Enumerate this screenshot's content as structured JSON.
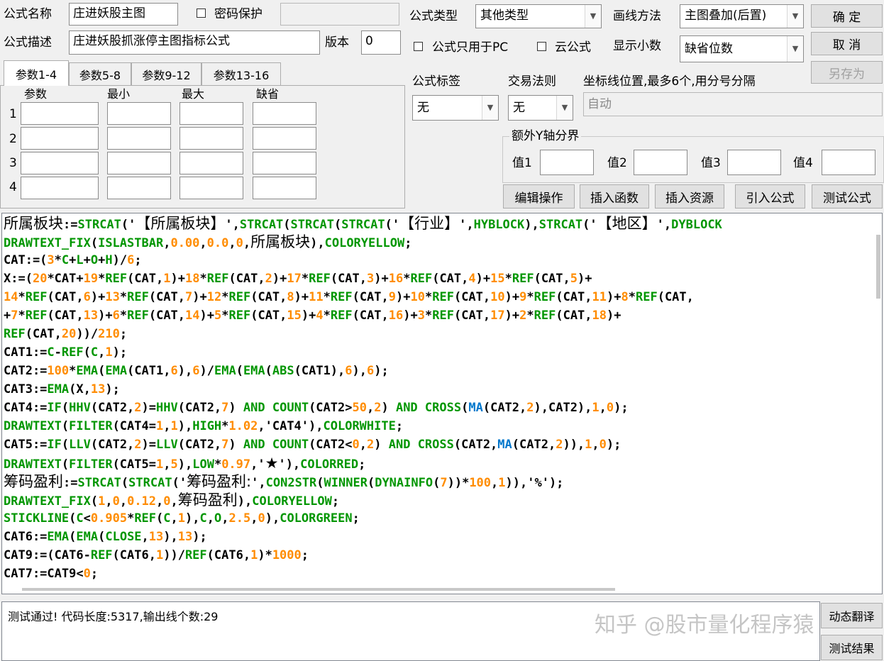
{
  "form": {
    "name_label": "公式名称",
    "name_value": "庄进妖股主图",
    "password_label": "密码保护",
    "desc_label": "公式描述",
    "desc_value": "庄进妖股抓涨停主图指标公式",
    "version_label": "版本",
    "version_value": "0",
    "type_label": "公式类型",
    "type_value": "其他类型",
    "draw_label": "画线方法",
    "draw_value": "主图叠加(后置)",
    "pc_only_label": "公式只用于PC",
    "cloud_label": "云公式",
    "decimal_label": "显示小数",
    "decimal_value": "缺省位数",
    "tag_label": "公式标签",
    "tag_value": "无",
    "trade_label": "交易法则",
    "trade_value": "无",
    "axis_label": "坐标线位置,最多6个,用分号分隔",
    "axis_placeholder": "自动",
    "yaxis_group": "额外Y轴分界",
    "y1": "值1",
    "y2": "值2",
    "y3": "值3",
    "y4": "值4"
  },
  "buttons": {
    "ok": "确  定",
    "cancel": "取  消",
    "save_as": "另存为",
    "edit": "编辑操作",
    "insert_func": "插入函数",
    "insert_res": "插入资源",
    "import": "引入公式",
    "test": "测试公式",
    "translate": "动态翻译",
    "test_result": "测试结果"
  },
  "tabs": [
    "参数1-4",
    "参数5-8",
    "参数9-12",
    "参数13-16"
  ],
  "params": {
    "headers": [
      "参数",
      "最小",
      "最大",
      "缺省"
    ],
    "rows": [
      "1",
      "2",
      "3",
      "4"
    ]
  },
  "code": [
    [
      [
        "cn",
        "所属板块"
      ],
      [
        "k",
        ":="
      ],
      [
        "f",
        "STRCAT"
      ],
      [
        "k",
        "('"
      ],
      [
        "cn",
        "【所属板块】"
      ],
      [
        "k",
        "',"
      ],
      [
        "f",
        "STRCAT"
      ],
      [
        "k",
        "("
      ],
      [
        "f",
        "STRCAT"
      ],
      [
        "k",
        "("
      ],
      [
        "f",
        "STRCAT"
      ],
      [
        "k",
        "('"
      ],
      [
        "cn",
        "【行业】"
      ],
      [
        "k",
        "',"
      ],
      [
        "f",
        "HYBLOCK"
      ],
      [
        "k",
        "),"
      ],
      [
        "f",
        "STRCAT"
      ],
      [
        "k",
        "('"
      ],
      [
        "cn",
        "【地区】"
      ],
      [
        "k",
        "',"
      ],
      [
        "f",
        "DYBLOCK"
      ]
    ],
    [
      [
        "f",
        "DRAWTEXT_FIX"
      ],
      [
        "k",
        "("
      ],
      [
        "f",
        "ISLASTBAR"
      ],
      [
        "k",
        ","
      ],
      [
        "n",
        "0.00"
      ],
      [
        "k",
        ","
      ],
      [
        "n",
        "0.0"
      ],
      [
        "k",
        ","
      ],
      [
        "n",
        "0"
      ],
      [
        "k",
        ","
      ],
      [
        "cn",
        "所属板块"
      ],
      [
        "k",
        "),"
      ],
      [
        "f",
        "COLORYELLOW"
      ],
      [
        "k",
        ";"
      ]
    ],
    [
      [
        "k",
        "CAT:=("
      ],
      [
        "n",
        "3"
      ],
      [
        "k",
        "*"
      ],
      [
        "f",
        "C"
      ],
      [
        "k",
        "+"
      ],
      [
        "f",
        "L"
      ],
      [
        "k",
        "+"
      ],
      [
        "f",
        "O"
      ],
      [
        "k",
        "+"
      ],
      [
        "f",
        "H"
      ],
      [
        "k",
        ")/"
      ],
      [
        "n",
        "6"
      ],
      [
        "k",
        ";"
      ]
    ],
    [
      [
        "k",
        "X:=("
      ],
      [
        "n",
        "20"
      ],
      [
        "k",
        "*CAT+"
      ],
      [
        "n",
        "19"
      ],
      [
        "k",
        "*"
      ],
      [
        "f",
        "REF"
      ],
      [
        "k",
        "(CAT,"
      ],
      [
        "n",
        "1"
      ],
      [
        "k",
        ")+"
      ],
      [
        "n",
        "18"
      ],
      [
        "k",
        "*"
      ],
      [
        "f",
        "REF"
      ],
      [
        "k",
        "(CAT,"
      ],
      [
        "n",
        "2"
      ],
      [
        "k",
        ")+"
      ],
      [
        "n",
        "17"
      ],
      [
        "k",
        "*"
      ],
      [
        "f",
        "REF"
      ],
      [
        "k",
        "(CAT,"
      ],
      [
        "n",
        "3"
      ],
      [
        "k",
        ")+"
      ],
      [
        "n",
        "16"
      ],
      [
        "k",
        "*"
      ],
      [
        "f",
        "REF"
      ],
      [
        "k",
        "(CAT,"
      ],
      [
        "n",
        "4"
      ],
      [
        "k",
        ")+"
      ],
      [
        "n",
        "15"
      ],
      [
        "k",
        "*"
      ],
      [
        "f",
        "REF"
      ],
      [
        "k",
        "(CAT,"
      ],
      [
        "n",
        "5"
      ],
      [
        "k",
        ")+"
      ]
    ],
    [
      [
        "n",
        "14"
      ],
      [
        "k",
        "*"
      ],
      [
        "f",
        "REF"
      ],
      [
        "k",
        "(CAT,"
      ],
      [
        "n",
        "6"
      ],
      [
        "k",
        ")+"
      ],
      [
        "n",
        "13"
      ],
      [
        "k",
        "*"
      ],
      [
        "f",
        "REF"
      ],
      [
        "k",
        "(CAT,"
      ],
      [
        "n",
        "7"
      ],
      [
        "k",
        ")+"
      ],
      [
        "n",
        "12"
      ],
      [
        "k",
        "*"
      ],
      [
        "f",
        "REF"
      ],
      [
        "k",
        "(CAT,"
      ],
      [
        "n",
        "8"
      ],
      [
        "k",
        ")+"
      ],
      [
        "n",
        "11"
      ],
      [
        "k",
        "*"
      ],
      [
        "f",
        "REF"
      ],
      [
        "k",
        "(CAT,"
      ],
      [
        "n",
        "9"
      ],
      [
        "k",
        ")+"
      ],
      [
        "n",
        "10"
      ],
      [
        "k",
        "*"
      ],
      [
        "f",
        "REF"
      ],
      [
        "k",
        "(CAT,"
      ],
      [
        "n",
        "10"
      ],
      [
        "k",
        ")+"
      ],
      [
        "n",
        "9"
      ],
      [
        "k",
        "*"
      ],
      [
        "f",
        "REF"
      ],
      [
        "k",
        "(CAT,"
      ],
      [
        "n",
        "11"
      ],
      [
        "k",
        ")+"
      ],
      [
        "n",
        "8"
      ],
      [
        "k",
        "*"
      ],
      [
        "f",
        "REF"
      ],
      [
        "k",
        "(CAT,"
      ]
    ],
    [
      [
        "k",
        "+"
      ],
      [
        "n",
        "7"
      ],
      [
        "k",
        "*"
      ],
      [
        "f",
        "REF"
      ],
      [
        "k",
        "(CAT,"
      ],
      [
        "n",
        "13"
      ],
      [
        "k",
        ")+"
      ],
      [
        "n",
        "6"
      ],
      [
        "k",
        "*"
      ],
      [
        "f",
        "REF"
      ],
      [
        "k",
        "(CAT,"
      ],
      [
        "n",
        "14"
      ],
      [
        "k",
        ")+"
      ],
      [
        "n",
        "5"
      ],
      [
        "k",
        "*"
      ],
      [
        "f",
        "REF"
      ],
      [
        "k",
        "(CAT,"
      ],
      [
        "n",
        "15"
      ],
      [
        "k",
        ")+"
      ],
      [
        "n",
        "4"
      ],
      [
        "k",
        "*"
      ],
      [
        "f",
        "REF"
      ],
      [
        "k",
        "(CAT,"
      ],
      [
        "n",
        "16"
      ],
      [
        "k",
        ")+"
      ],
      [
        "n",
        "3"
      ],
      [
        "k",
        "*"
      ],
      [
        "f",
        "REF"
      ],
      [
        "k",
        "(CAT,"
      ],
      [
        "n",
        "17"
      ],
      [
        "k",
        ")+"
      ],
      [
        "n",
        "2"
      ],
      [
        "k",
        "*"
      ],
      [
        "f",
        "REF"
      ],
      [
        "k",
        "(CAT,"
      ],
      [
        "n",
        "18"
      ],
      [
        "k",
        ")+"
      ]
    ],
    [
      [
        "f",
        "REF"
      ],
      [
        "k",
        "(CAT,"
      ],
      [
        "n",
        "20"
      ],
      [
        "k",
        "))/"
      ],
      [
        "n",
        "210"
      ],
      [
        "k",
        ";"
      ]
    ],
    [
      [
        "k",
        "CAT1:="
      ],
      [
        "f",
        "C"
      ],
      [
        "k",
        "-"
      ],
      [
        "f",
        "REF"
      ],
      [
        "k",
        "("
      ],
      [
        "f",
        "C"
      ],
      [
        "k",
        ","
      ],
      [
        "n",
        "1"
      ],
      [
        "k",
        ");"
      ]
    ],
    [
      [
        "k",
        "CAT2:="
      ],
      [
        "n",
        "100"
      ],
      [
        "k",
        "*"
      ],
      [
        "f",
        "EMA"
      ],
      [
        "k",
        "("
      ],
      [
        "f",
        "EMA"
      ],
      [
        "k",
        "(CAT1,"
      ],
      [
        "n",
        "6"
      ],
      [
        "k",
        "),"
      ],
      [
        "n",
        "6"
      ],
      [
        "k",
        ")/"
      ],
      [
        "f",
        "EMA"
      ],
      [
        "k",
        "("
      ],
      [
        "f",
        "EMA"
      ],
      [
        "k",
        "("
      ],
      [
        "f",
        "ABS"
      ],
      [
        "k",
        "(CAT1),"
      ],
      [
        "n",
        "6"
      ],
      [
        "k",
        "),"
      ],
      [
        "n",
        "6"
      ],
      [
        "k",
        ");"
      ]
    ],
    [
      [
        "k",
        "CAT3:="
      ],
      [
        "f",
        "EMA"
      ],
      [
        "k",
        "(X,"
      ],
      [
        "n",
        "13"
      ],
      [
        "k",
        ");"
      ]
    ],
    [
      [
        "k",
        "CAT4:="
      ],
      [
        "f",
        "IF"
      ],
      [
        "k",
        "("
      ],
      [
        "f",
        "HHV"
      ],
      [
        "k",
        "(CAT2,"
      ],
      [
        "n",
        "2"
      ],
      [
        "k",
        ")="
      ],
      [
        "f",
        "HHV"
      ],
      [
        "k",
        "(CAT2,"
      ],
      [
        "n",
        "7"
      ],
      [
        "k",
        ") "
      ],
      [
        "f",
        "AND"
      ],
      [
        "k",
        " "
      ],
      [
        "f",
        "COUNT"
      ],
      [
        "k",
        "(CAT2>"
      ],
      [
        "n",
        "50"
      ],
      [
        "k",
        ","
      ],
      [
        "n",
        "2"
      ],
      [
        "k",
        ") "
      ],
      [
        "f",
        "AND"
      ],
      [
        "k",
        " "
      ],
      [
        "f",
        "CROSS"
      ],
      [
        "k",
        "("
      ],
      [
        "m",
        "MA"
      ],
      [
        "k",
        "(CAT2,"
      ],
      [
        "n",
        "2"
      ],
      [
        "k",
        "),CAT2),"
      ],
      [
        "n",
        "1"
      ],
      [
        "k",
        ","
      ],
      [
        "n",
        "0"
      ],
      [
        "k",
        ");"
      ]
    ],
    [
      [
        "f",
        "DRAWTEXT"
      ],
      [
        "k",
        "("
      ],
      [
        "f",
        "FILTER"
      ],
      [
        "k",
        "(CAT4="
      ],
      [
        "n",
        "1"
      ],
      [
        "k",
        ","
      ],
      [
        "n",
        "1"
      ],
      [
        "k",
        "),"
      ],
      [
        "f",
        "HIGH"
      ],
      [
        "k",
        "*"
      ],
      [
        "n",
        "1.02"
      ],
      [
        "k",
        ",'CAT4'),"
      ],
      [
        "f",
        "COLORWHITE"
      ],
      [
        "k",
        ";"
      ]
    ],
    [
      [
        "k",
        "CAT5:="
      ],
      [
        "f",
        "IF"
      ],
      [
        "k",
        "("
      ],
      [
        "f",
        "LLV"
      ],
      [
        "k",
        "(CAT2,"
      ],
      [
        "n",
        "2"
      ],
      [
        "k",
        ")="
      ],
      [
        "f",
        "LLV"
      ],
      [
        "k",
        "(CAT2,"
      ],
      [
        "n",
        "7"
      ],
      [
        "k",
        ") "
      ],
      [
        "f",
        "AND"
      ],
      [
        "k",
        " "
      ],
      [
        "f",
        "COUNT"
      ],
      [
        "k",
        "(CAT2<"
      ],
      [
        "n",
        "0"
      ],
      [
        "k",
        ","
      ],
      [
        "n",
        "2"
      ],
      [
        "k",
        ") "
      ],
      [
        "f",
        "AND"
      ],
      [
        "k",
        " "
      ],
      [
        "f",
        "CROSS"
      ],
      [
        "k",
        "(CAT2,"
      ],
      [
        "m",
        "MA"
      ],
      [
        "k",
        "(CAT2,"
      ],
      [
        "n",
        "2"
      ],
      [
        "k",
        ")),"
      ],
      [
        "n",
        "1"
      ],
      [
        "k",
        ","
      ],
      [
        "n",
        "0"
      ],
      [
        "k",
        ");"
      ]
    ],
    [
      [
        "f",
        "DRAWTEXT"
      ],
      [
        "k",
        "("
      ],
      [
        "f",
        "FILTER"
      ],
      [
        "k",
        "(CAT5="
      ],
      [
        "n",
        "1"
      ],
      [
        "k",
        ","
      ],
      [
        "n",
        "5"
      ],
      [
        "k",
        "),"
      ],
      [
        "f",
        "LOW"
      ],
      [
        "k",
        "*"
      ],
      [
        "n",
        "0.97"
      ],
      [
        "k",
        ",'"
      ],
      [
        "cn",
        "★"
      ],
      [
        "k",
        "'),"
      ],
      [
        "f",
        "COLORRED"
      ],
      [
        "k",
        ";"
      ]
    ],
    [
      [
        "cn",
        "筹码盈利"
      ],
      [
        "k",
        ":="
      ],
      [
        "f",
        "STRCAT"
      ],
      [
        "k",
        "("
      ],
      [
        "f",
        "STRCAT"
      ],
      [
        "k",
        "('"
      ],
      [
        "cn",
        "筹码盈利:"
      ],
      [
        "k",
        "',"
      ],
      [
        "f",
        "CON2STR"
      ],
      [
        "k",
        "("
      ],
      [
        "f",
        "WINNER"
      ],
      [
        "k",
        "("
      ],
      [
        "f",
        "DYNAINFO"
      ],
      [
        "k",
        "("
      ],
      [
        "n",
        "7"
      ],
      [
        "k",
        "))*"
      ],
      [
        "n",
        "100"
      ],
      [
        "k",
        ","
      ],
      [
        "n",
        "1"
      ],
      [
        "k",
        ")),'%');"
      ]
    ],
    [
      [
        "f",
        "DRAWTEXT_FIX"
      ],
      [
        "k",
        "("
      ],
      [
        "n",
        "1"
      ],
      [
        "k",
        ","
      ],
      [
        "n",
        "0"
      ],
      [
        "k",
        ","
      ],
      [
        "n",
        "0.12"
      ],
      [
        "k",
        ","
      ],
      [
        "n",
        "0"
      ],
      [
        "k",
        ","
      ],
      [
        "cn",
        "筹码盈利"
      ],
      [
        "k",
        "),"
      ],
      [
        "f",
        "COLORYELLOW"
      ],
      [
        "k",
        ";"
      ]
    ],
    [
      [
        "f",
        "STICKLINE"
      ],
      [
        "k",
        "("
      ],
      [
        "f",
        "C"
      ],
      [
        "k",
        "<"
      ],
      [
        "n",
        "0.905"
      ],
      [
        "k",
        "*"
      ],
      [
        "f",
        "REF"
      ],
      [
        "k",
        "("
      ],
      [
        "f",
        "C"
      ],
      [
        "k",
        ","
      ],
      [
        "n",
        "1"
      ],
      [
        "k",
        "),"
      ],
      [
        "f",
        "C"
      ],
      [
        "k",
        ","
      ],
      [
        "f",
        "O"
      ],
      [
        "k",
        ","
      ],
      [
        "n",
        "2.5"
      ],
      [
        "k",
        ","
      ],
      [
        "n",
        "0"
      ],
      [
        "k",
        "),"
      ],
      [
        "f",
        "COLORGREEN"
      ],
      [
        "k",
        ";"
      ]
    ],
    [
      [
        "k",
        "CAT6:="
      ],
      [
        "f",
        "EMA"
      ],
      [
        "k",
        "("
      ],
      [
        "f",
        "EMA"
      ],
      [
        "k",
        "("
      ],
      [
        "f",
        "CLOSE"
      ],
      [
        "k",
        ","
      ],
      [
        "n",
        "13"
      ],
      [
        "k",
        "),"
      ],
      [
        "n",
        "13"
      ],
      [
        "k",
        ");"
      ]
    ],
    [
      [
        "k",
        "CAT9:=(CAT6-"
      ],
      [
        "f",
        "REF"
      ],
      [
        "k",
        "(CAT6,"
      ],
      [
        "n",
        "1"
      ],
      [
        "k",
        "))/"
      ],
      [
        "f",
        "REF"
      ],
      [
        "k",
        "(CAT6,"
      ],
      [
        "n",
        "1"
      ],
      [
        "k",
        ")*"
      ],
      [
        "n",
        "1000"
      ],
      [
        "k",
        ";"
      ]
    ],
    [
      [
        "k",
        "CAT7:=CAT9<"
      ],
      [
        "n",
        "0"
      ],
      [
        "k",
        ";"
      ]
    ]
  ],
  "status": {
    "message": "测试通过! 代码长度:5317,输出线个数:29",
    "watermark": "知乎 @股市量化程序猿"
  }
}
